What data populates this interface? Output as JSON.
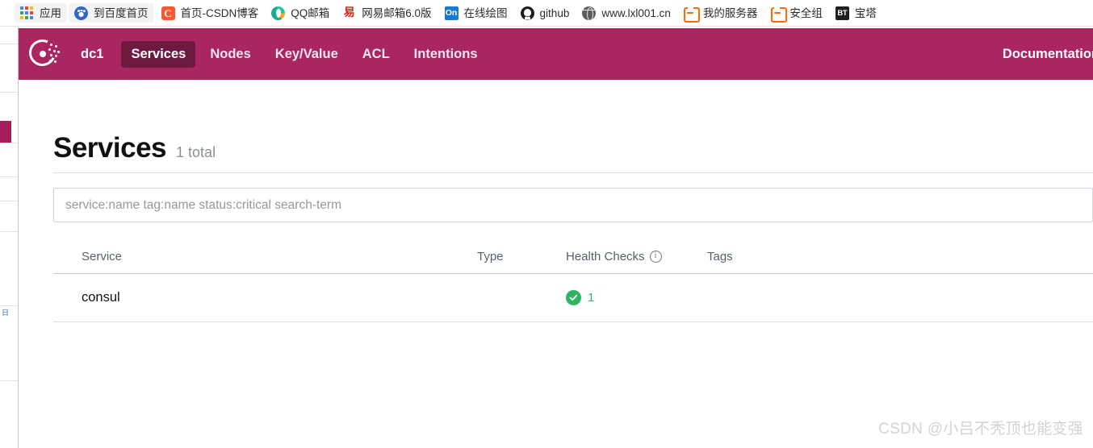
{
  "browser": {
    "bookmarks": [
      {
        "label": "应用",
        "icon": "apps-grid-icon"
      },
      {
        "label": "到百度首页",
        "icon": "baidu-icon"
      },
      {
        "label": "首页-CSDN博客",
        "icon": "csdn-icon",
        "glyph": "C"
      },
      {
        "label": "QQ邮箱",
        "icon": "qq-mail-icon"
      },
      {
        "label": "网易邮箱6.0版",
        "icon": "netease-mail-icon",
        "glyph": "易"
      },
      {
        "label": "在线绘图",
        "icon": "online-draw-icon",
        "glyph": "On"
      },
      {
        "label": "github",
        "icon": "github-icon"
      },
      {
        "label": "www.lxl001.cn",
        "icon": "globe-icon"
      },
      {
        "label": "我的服务器",
        "icon": "bracket-icon"
      },
      {
        "label": "安全组",
        "icon": "bracket-icon"
      },
      {
        "label": "宝塔",
        "icon": "baota-icon",
        "glyph": "BT"
      }
    ]
  },
  "consul": {
    "logo_name": "consul-logo",
    "datacenter": "dc1",
    "nav": [
      {
        "label": "Services",
        "active": true
      },
      {
        "label": "Nodes",
        "active": false
      },
      {
        "label": "Key/Value",
        "active": false
      },
      {
        "label": "ACL",
        "active": false
      },
      {
        "label": "Intentions",
        "active": false
      }
    ],
    "documentation_label": "Documentation",
    "nav_bg_color": "#aa2660",
    "nav_active_color": "#6d1a3e"
  },
  "page": {
    "title": "Services",
    "count_label": "1 total",
    "search": {
      "placeholder": "service:name tag:name status:critical search-term",
      "value": ""
    },
    "table": {
      "headers": {
        "service": "Service",
        "type": "Type",
        "health_checks": "Health Checks",
        "health_info_glyph": "i",
        "tags": "Tags"
      },
      "rows": [
        {
          "service": "consul",
          "type": "",
          "health_status": "passing",
          "health_count": "1",
          "health_color": "#2eb562",
          "tags": ""
        }
      ]
    }
  },
  "watermark": "CSDN @小吕不秃顶也能变强"
}
